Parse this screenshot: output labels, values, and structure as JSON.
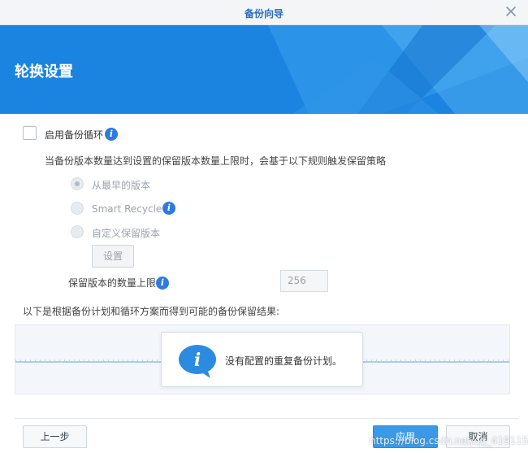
{
  "window": {
    "title": "备份向导"
  },
  "banner": {
    "heading": "轮换设置"
  },
  "rotation": {
    "enable_label": "启用备份循环",
    "enable_checked": false,
    "description": "当备份版本数量达到设置的保留版本数量上限时，会基于以下规则触发保留策略",
    "options": [
      {
        "label": "从最早的版本",
        "selected": true
      },
      {
        "label": "Smart Recycle",
        "selected": false
      },
      {
        "label": "自定义保留版本",
        "selected": false
      }
    ],
    "settings_button": "设置",
    "max_versions_label": "保留版本的数量上限",
    "max_versions_value": "256"
  },
  "preview": {
    "caption": "以下是根据备份计划和循环方案而得到可能的备份保留结果:",
    "message": "没有配置的重复备份计划。"
  },
  "footer": {
    "back_label": "上一步",
    "apply_label": "应用",
    "cancel_label": "取消"
  },
  "watermark": "https://blog.csdn.net/qq_41911532",
  "colors": {
    "accent": "#2b7be3",
    "banner": "#1e88e5",
    "primary_button": "#3b9ae8"
  }
}
